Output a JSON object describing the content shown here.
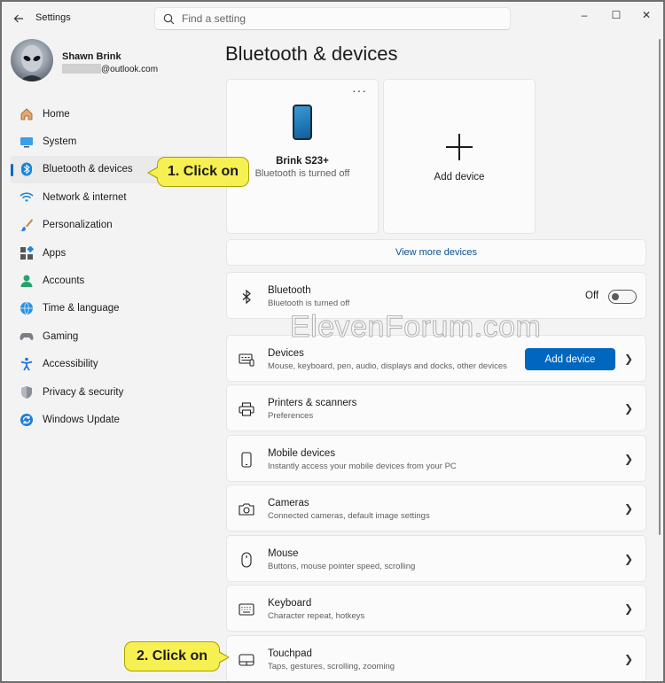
{
  "app": {
    "title": "Settings"
  },
  "search": {
    "placeholder": "Find a setting"
  },
  "window_controls": {
    "minimize": "–",
    "maximize": "☐",
    "close": "✕"
  },
  "user": {
    "name": "Shawn Brink",
    "email_domain": "@outlook.com"
  },
  "sidebar": {
    "items": [
      {
        "label": "Home",
        "icon": "home-icon"
      },
      {
        "label": "System",
        "icon": "system-icon"
      },
      {
        "label": "Bluetooth & devices",
        "icon": "bluetooth-icon",
        "active": true
      },
      {
        "label": "Network & internet",
        "icon": "wifi-icon"
      },
      {
        "label": "Personalization",
        "icon": "brush-icon"
      },
      {
        "label": "Apps",
        "icon": "apps-icon"
      },
      {
        "label": "Accounts",
        "icon": "accounts-icon"
      },
      {
        "label": "Time & language",
        "icon": "globe-icon"
      },
      {
        "label": "Gaming",
        "icon": "gamepad-icon"
      },
      {
        "label": "Accessibility",
        "icon": "accessibility-icon"
      },
      {
        "label": "Privacy & security",
        "icon": "shield-icon"
      },
      {
        "label": "Windows Update",
        "icon": "update-icon"
      }
    ]
  },
  "main": {
    "title": "Bluetooth & devices",
    "device_card": {
      "name": "Brink S23+",
      "status": "Bluetooth is turned off",
      "more": "···"
    },
    "add_card": {
      "label": "Add device"
    },
    "view_more": "View more devices",
    "bluetooth_row": {
      "title": "Bluetooth",
      "sub": "Bluetooth is turned off",
      "toggle_label": "Off",
      "toggle_on": false
    },
    "rows": [
      {
        "title": "Devices",
        "sub": "Mouse, keyboard, pen, audio, displays and docks, other devices",
        "button": "Add device",
        "icon": "devices-icon"
      },
      {
        "title": "Printers & scanners",
        "sub": "Preferences",
        "icon": "printer-icon"
      },
      {
        "title": "Mobile devices",
        "sub": "Instantly access your mobile devices from your PC",
        "icon": "phone-icon"
      },
      {
        "title": "Cameras",
        "sub": "Connected cameras, default image settings",
        "icon": "camera-icon"
      },
      {
        "title": "Mouse",
        "sub": "Buttons, mouse pointer speed, scrolling",
        "icon": "mouse-icon"
      },
      {
        "title": "Keyboard",
        "sub": "Character repeat, hotkeys",
        "icon": "keyboard-icon"
      },
      {
        "title": "Touchpad",
        "sub": "Taps, gestures, scrolling, zooming",
        "icon": "touchpad-icon"
      }
    ]
  },
  "watermark": "ElevenForum.com",
  "callouts": {
    "first": "1. Click on",
    "second": "2. Click on"
  },
  "colors": {
    "accent": "#0067c0",
    "callout": "#f6f052",
    "background": "#f3f3f3"
  }
}
